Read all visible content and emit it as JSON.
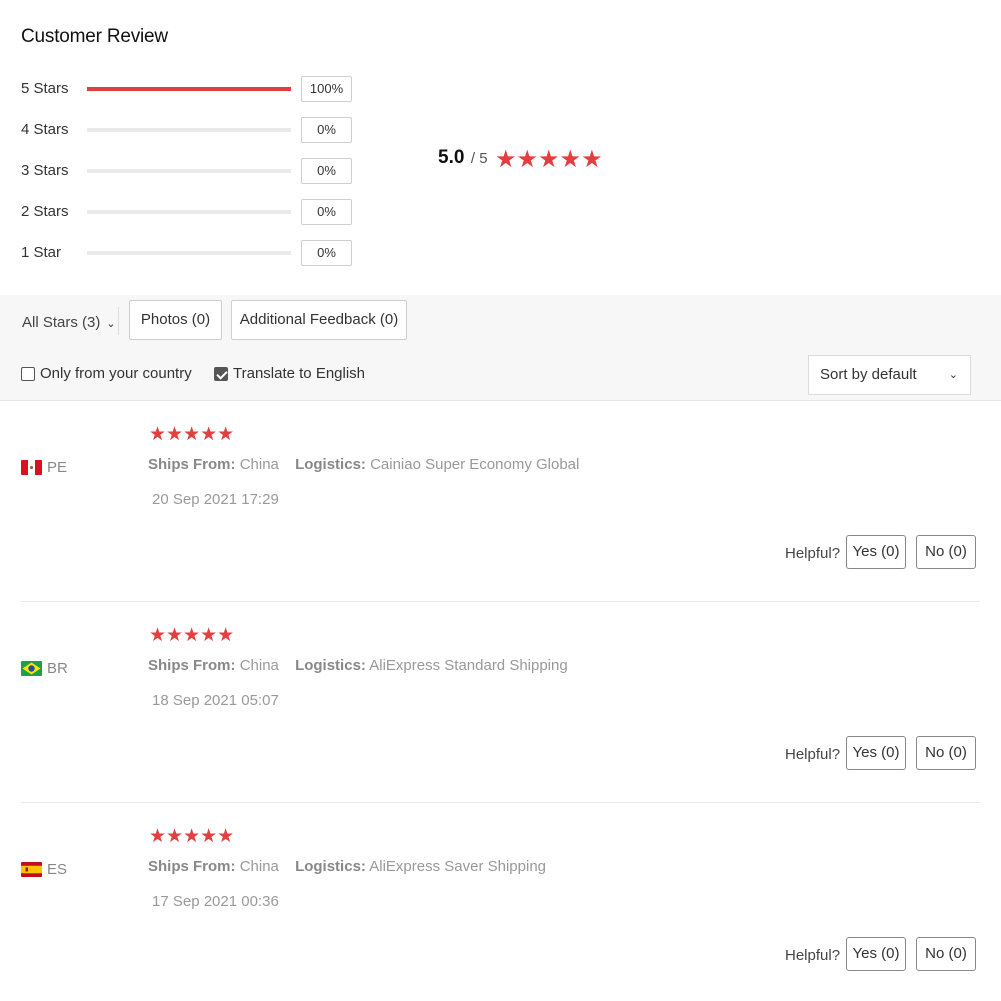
{
  "header": {
    "title": "Customer Review"
  },
  "distribution": [
    {
      "label": "5 Stars",
      "pct": "100%",
      "fill": 1.0
    },
    {
      "label": "4 Stars",
      "pct": "0%",
      "fill": 0
    },
    {
      "label": "3 Stars",
      "pct": "0%",
      "fill": 0
    },
    {
      "label": "2 Stars",
      "pct": "0%",
      "fill": 0
    },
    {
      "label": "1 Star",
      "pct": "0%",
      "fill": 0
    }
  ],
  "average": {
    "value": "5.0",
    "out_of": "/ 5",
    "stars": "★★★★★",
    "rating": 5
  },
  "filters": {
    "all_stars": "All Stars (3)",
    "photos": "Photos (0)",
    "additional_feedback": "Additional Feedback (0)"
  },
  "options": {
    "only_country": {
      "label": "Only from your country",
      "checked": false
    },
    "translate": {
      "label": "Translate to English",
      "checked": true
    },
    "sort": "Sort by default"
  },
  "reviews": [
    {
      "country": "PE",
      "flag": "peru-flag-icon",
      "stars": "★★★★★",
      "rating": 5,
      "ships_from_label": "Ships From:",
      "ships_from": "China",
      "logistics_label": "Logistics:",
      "logistics": "Cainiao Super Economy Global",
      "date": "20 Sep 2021 17:29",
      "helpful_label": "Helpful?",
      "yes": "Yes (0)",
      "no": "No (0)"
    },
    {
      "country": "BR",
      "flag": "brazil-flag-icon",
      "stars": "★★★★★",
      "rating": 5,
      "ships_from_label": "Ships From:",
      "ships_from": "China",
      "logistics_label": "Logistics:",
      "logistics": "AliExpress Standard Shipping",
      "date": "18 Sep 2021 05:07",
      "helpful_label": "Helpful?",
      "yes": "Yes (0)",
      "no": "No (0)"
    },
    {
      "country": "ES",
      "flag": "spain-flag-icon",
      "stars": "★★★★★",
      "rating": 5,
      "ships_from_label": "Ships From:",
      "ships_from": "China",
      "logistics_label": "Logistics:",
      "logistics": "AliExpress Saver Shipping",
      "date": "17 Sep 2021 00:36",
      "helpful_label": "Helpful?",
      "yes": "Yes (0)",
      "no": "No (0)"
    }
  ],
  "colors": {
    "accent": "#e43f40",
    "track": "#eaeaea",
    "bar_bg": "#f7f7f7"
  }
}
